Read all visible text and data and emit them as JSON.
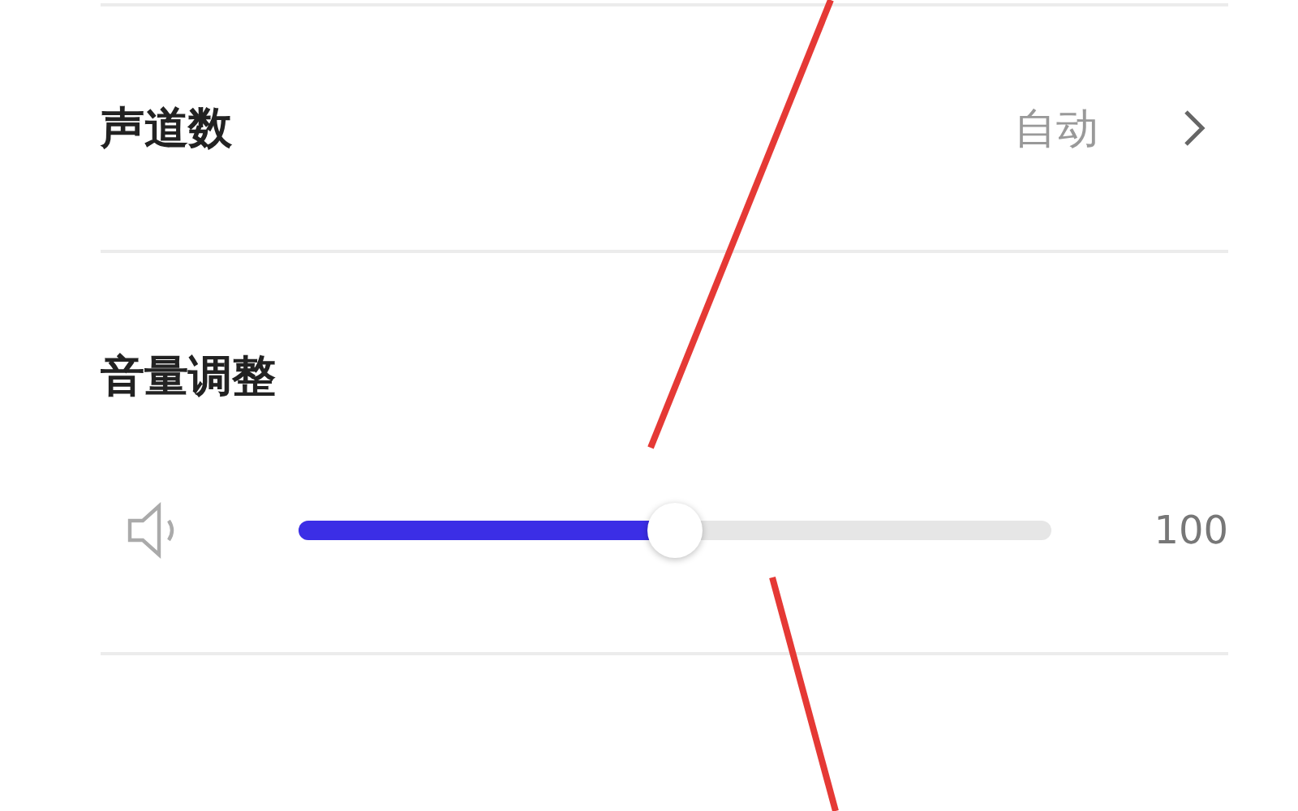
{
  "channels_row": {
    "label": "声道数",
    "value": "自动"
  },
  "volume": {
    "title": "音量调整",
    "level": 0.5,
    "reading": "100"
  }
}
